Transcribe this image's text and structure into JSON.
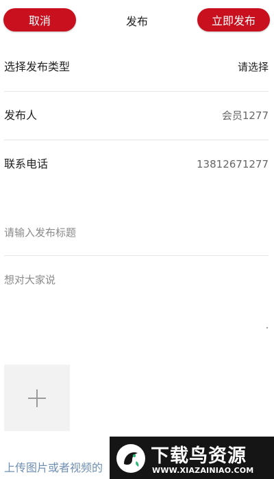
{
  "header": {
    "cancel_label": "取消",
    "title": "发布",
    "publish_label": "立即发布"
  },
  "form": {
    "type_row": {
      "label": "选择发布类型",
      "value": "请选择"
    },
    "publisher_row": {
      "label": "发布人",
      "value": "会员1277"
    },
    "phone_row": {
      "label": "联系电话",
      "value": "13812671277"
    },
    "title_placeholder": "请输入发布标题",
    "content_placeholder": "想对大家说",
    "upload_hint": "上传图片或者视频的"
  },
  "watermark": {
    "title": "下载鸟资源",
    "url": "WWW.XIAZAINIAO.COM"
  },
  "colors": {
    "accent": "#c8101f",
    "hint_blue": "#6f8fb3"
  },
  "icons": {
    "add": "plus-icon",
    "watermark_logo": "bird-logo-icon"
  }
}
